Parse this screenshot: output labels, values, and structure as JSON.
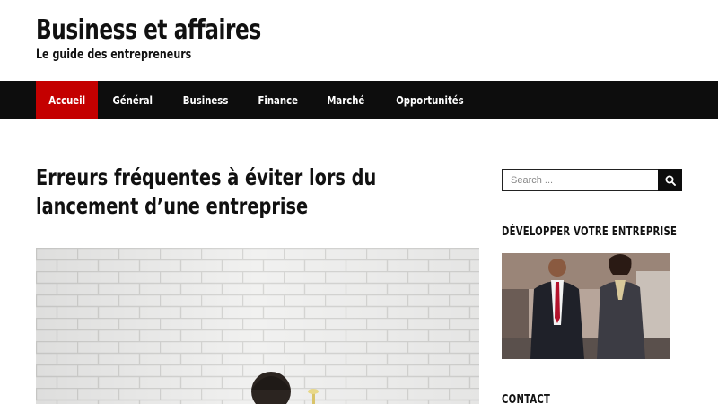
{
  "site": {
    "title": "Business et affaires",
    "description": "Le guide des entrepreneurs"
  },
  "nav": {
    "items": [
      {
        "label": "Accueil",
        "active": true
      },
      {
        "label": "Général",
        "active": false
      },
      {
        "label": "Business",
        "active": false
      },
      {
        "label": "Finance",
        "active": false
      },
      {
        "label": "Marché",
        "active": false
      },
      {
        "label": "Opportunités",
        "active": false
      }
    ]
  },
  "post": {
    "title": "Erreurs fréquentes à éviter lors du lancement d’une entreprise"
  },
  "sidebar": {
    "search": {
      "placeholder": "Search ..."
    },
    "widget1_title": "DÉVELOPPER VOTRE ENTREPRISE",
    "widget2_title": "CONTACT"
  },
  "colors": {
    "nav_background": "#0d0d0d",
    "active_nav": "#c40000"
  }
}
